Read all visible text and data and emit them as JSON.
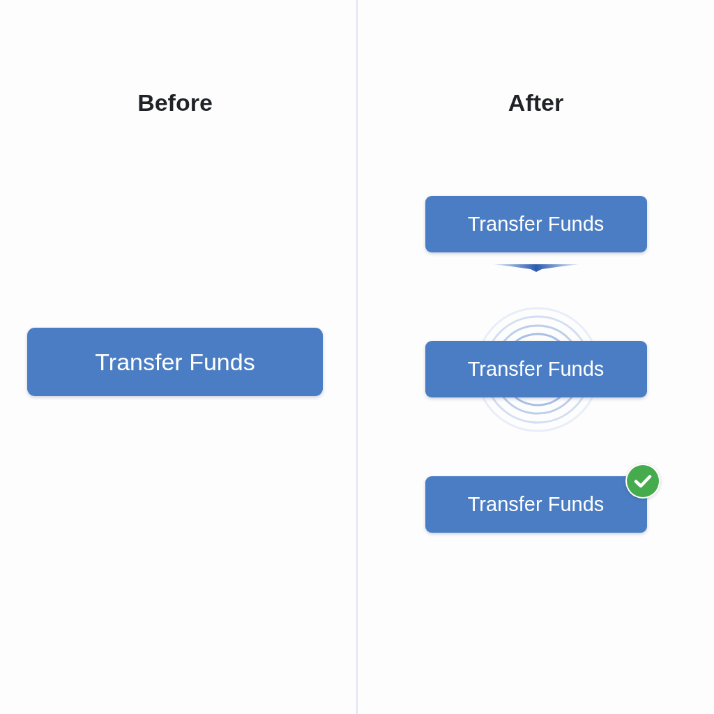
{
  "panels": [
    {
      "heading": "Before",
      "buttons": [
        {
          "label": "Transfer Funds",
          "kind": "plain"
        }
      ]
    },
    {
      "heading": "After",
      "buttons": [
        {
          "label": "Transfer Funds",
          "kind": "press"
        },
        {
          "label": "Transfer Funds",
          "kind": "ripple"
        },
        {
          "label": "Transfer Funds",
          "kind": "success"
        }
      ]
    }
  ]
}
